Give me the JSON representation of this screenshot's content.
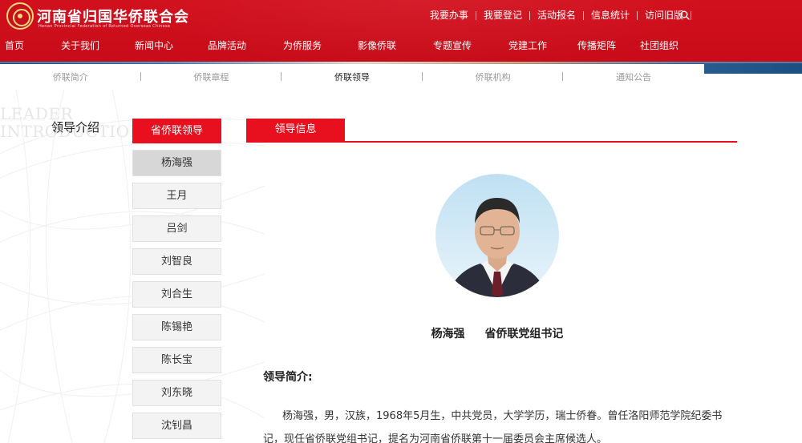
{
  "logo": {
    "name_cn": "河南省归国华侨联合会",
    "name_en": "Henan Provincial Federation of Returned Overseas Chinese"
  },
  "top_links": [
    "我要办事",
    "我要登记",
    "活动报名",
    "信息统计",
    "访问旧版"
  ],
  "main_nav": [
    "首页",
    "关于我们",
    "新闻中心",
    "品牌活动",
    "为侨服务",
    "影像侨联",
    "专题宣传",
    "党建工作",
    "传播矩阵",
    "社团组织"
  ],
  "sub_nav": {
    "items": [
      "侨联简介",
      "侨联章程",
      "侨联领导",
      "侨联机构",
      "通知公告"
    ],
    "active_index": 2
  },
  "section": {
    "en_line1": "LEADER",
    "en_line2": "INTRODUCTION",
    "title_cn": "领导介绍"
  },
  "sidebar": {
    "title": "省侨联领导",
    "items": [
      "杨海强",
      "王月",
      "吕剑",
      "刘智良",
      "刘合生",
      "陈锡艳",
      "陈长宝",
      "刘东晓",
      "沈钊昌"
    ],
    "active_index": 0
  },
  "content": {
    "tab": "领导信息",
    "name": "杨海强",
    "position": "省侨联党组书记",
    "intro_title": "领导简介:",
    "intro_text": "杨海强，男，汉族，1968年5月生，中共党员，大学学历，瑞士侨眷。曾任洛阳师范学院纪委书记，现任省侨联党组书记，提名为河南省侨联第十一届委员会主席候选人。"
  },
  "colors": {
    "brand_red": "#e8101e",
    "header_red": "#c60b18",
    "active_side_bg": "#d7d7d7"
  }
}
